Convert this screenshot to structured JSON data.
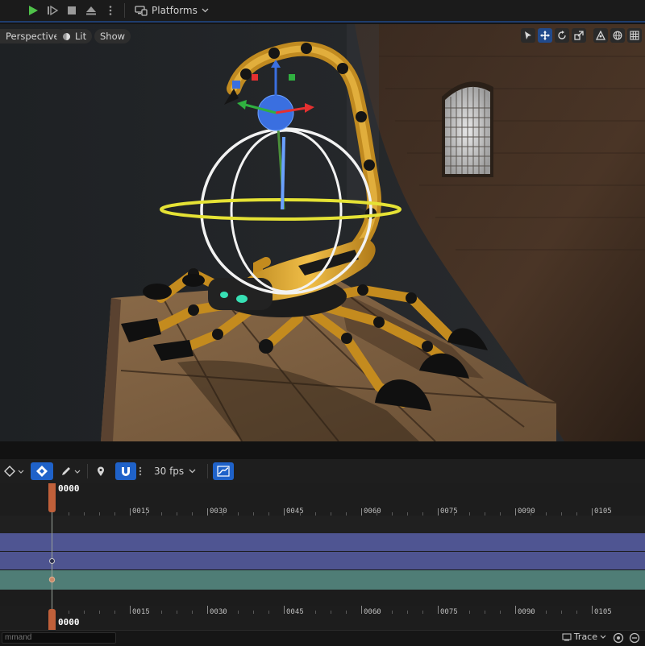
{
  "toolbar": {
    "platforms_label": "Platforms"
  },
  "viewport": {
    "perspective_label": "Perspective",
    "lit_label": "Lit",
    "show_label": "Show"
  },
  "sequencer": {
    "fps_label": "30 fps",
    "current_frame": "0000",
    "ruler_ticks": [
      "0015",
      "0030",
      "0045",
      "0060",
      "0075",
      "0090",
      "0105"
    ]
  },
  "status_bar": {
    "command_placeholder": "mmand",
    "trace_label": "Trace"
  },
  "colors": {
    "accent_blue": "#1f62c9",
    "playhead": "#c0603a",
    "track_blue": "#4f5592",
    "track_teal": "#4f7d76",
    "play_green": "#4fc24a"
  }
}
